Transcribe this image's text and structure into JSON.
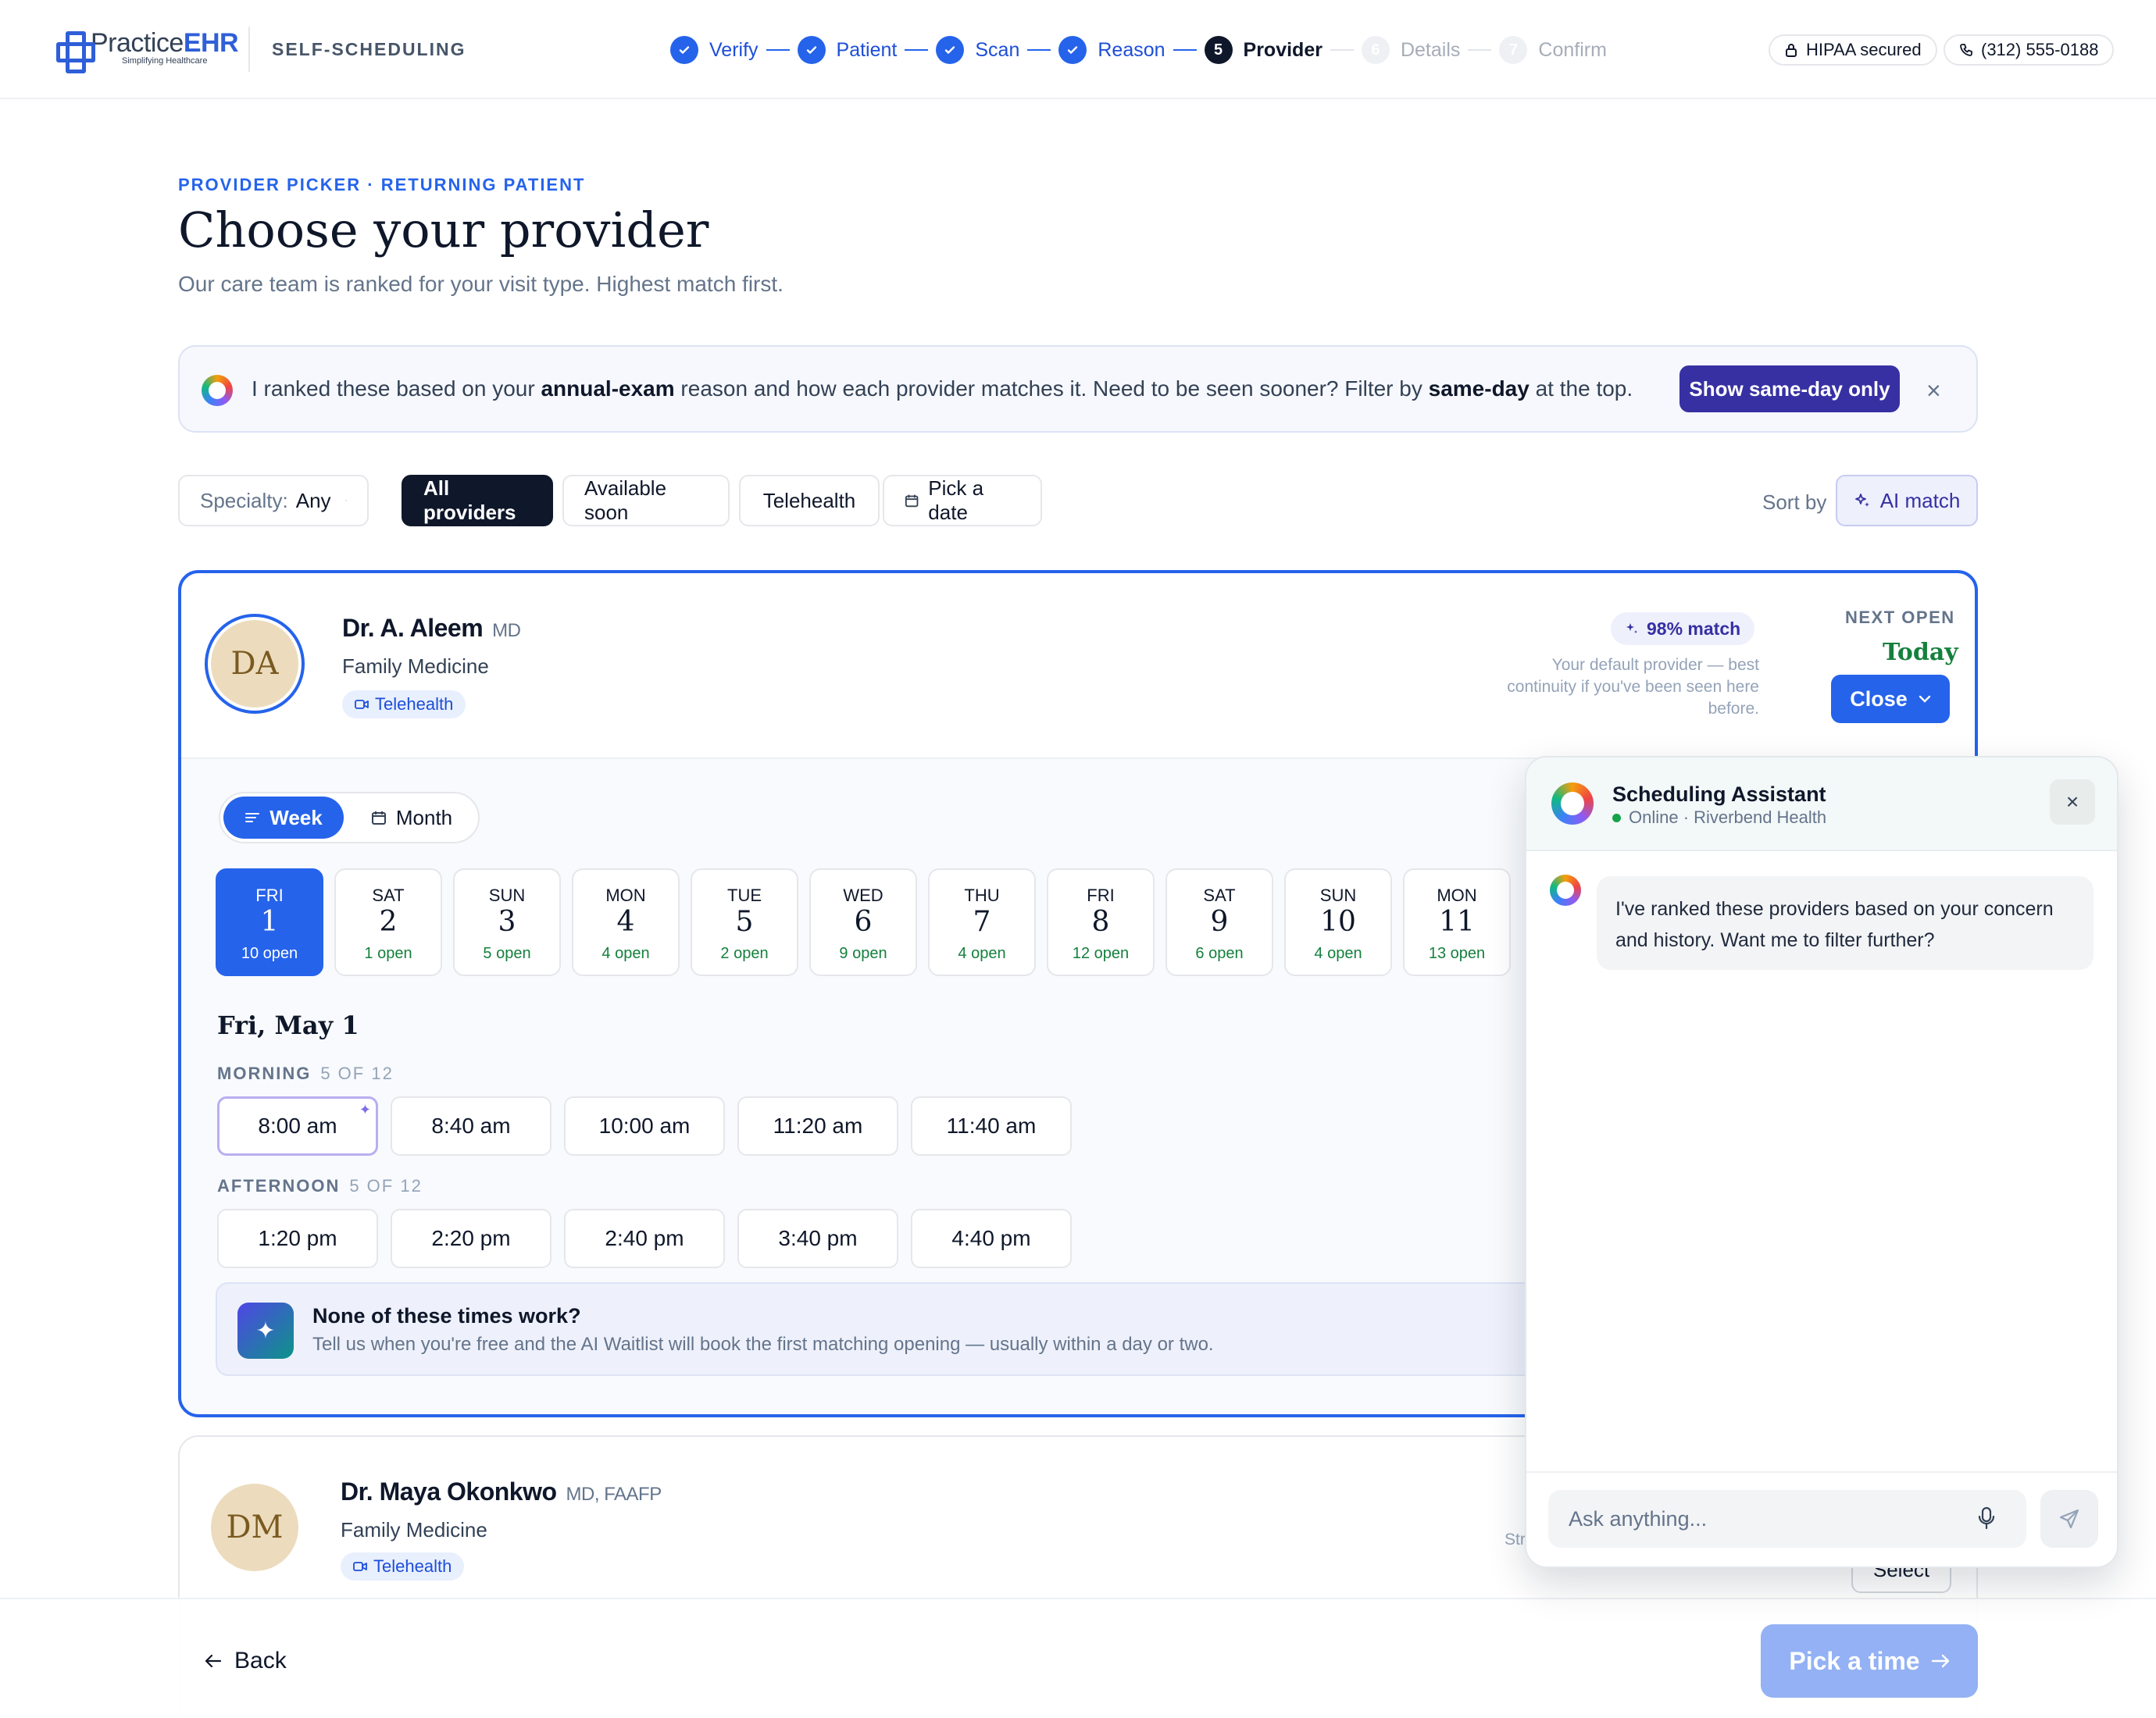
{
  "header": {
    "logo_practice": "Practice",
    "logo_ehr": "EHR",
    "logo_tagline": "Simplifying Healthcare",
    "section": "SELF-SCHEDULING",
    "steps": [
      {
        "label": "Verify",
        "state": "done"
      },
      {
        "label": "Patient",
        "state": "done"
      },
      {
        "label": "Scan",
        "state": "done"
      },
      {
        "label": "Reason",
        "state": "done"
      },
      {
        "label": "Provider",
        "number": "5",
        "state": "current"
      },
      {
        "label": "Details",
        "number": "6",
        "state": "todo"
      },
      {
        "label": "Confirm",
        "number": "7",
        "state": "todo"
      }
    ],
    "hipaa": "HIPAA secured",
    "phone": "(312) 555-0188"
  },
  "page": {
    "eyebrow": "PROVIDER PICKER · RETURNING PATIENT",
    "title": "Choose your provider",
    "subtitle": "Our care team is ranked for your visit type. Highest match first."
  },
  "banner": {
    "text_1": "I ranked these based on your ",
    "bold_1": "annual-exam",
    "text_2": " reason and how each provider matches it. Need to be seen sooner? Filter by ",
    "bold_2": "same-day",
    "text_3": " at the top.",
    "button": "Show same-day only",
    "close": "×"
  },
  "filters": {
    "specialty_label": "Specialty:",
    "specialty_value": "Any",
    "chips": [
      "All providers",
      "Available soon",
      "Telehealth",
      "Pick a date"
    ],
    "sort_label": "Sort by",
    "sort_value": "AI match"
  },
  "provider1": {
    "initials": "DA",
    "name": "Dr. A. Aleem",
    "credentials": "MD",
    "specialty": "Family Medicine",
    "tag": "Telehealth",
    "match": "98% match",
    "note": "Your default provider — best continuity if you've been seen here before.",
    "next_open_label": "NEXT OPEN",
    "next_open_value": "Today",
    "button": "Close",
    "view_week": "Week",
    "view_month": "Month",
    "days": [
      {
        "dow": "FRI",
        "num": "1",
        "open": "10 open",
        "selected": true
      },
      {
        "dow": "SAT",
        "num": "2",
        "open": "1 open"
      },
      {
        "dow": "SUN",
        "num": "3",
        "open": "5 open"
      },
      {
        "dow": "MON",
        "num": "4",
        "open": "4 open"
      },
      {
        "dow": "TUE",
        "num": "5",
        "open": "2 open"
      },
      {
        "dow": "WED",
        "num": "6",
        "open": "9 open"
      },
      {
        "dow": "THU",
        "num": "7",
        "open": "4 open"
      },
      {
        "dow": "FRI",
        "num": "8",
        "open": "12 open"
      },
      {
        "dow": "SAT",
        "num": "9",
        "open": "6 open"
      },
      {
        "dow": "SUN",
        "num": "10",
        "open": "4 open"
      },
      {
        "dow": "MON",
        "num": "11",
        "open": "13 open"
      }
    ],
    "date_heading": "Fri, May 1",
    "morning_label": "MORNING",
    "morning_count": "5 OF 12",
    "morning_slots": [
      "8:00 am",
      "8:40 am",
      "10:00 am",
      "11:20 am",
      "11:40 am"
    ],
    "afternoon_label": "AFTERNOON",
    "afternoon_count": "5 OF 12",
    "afternoon_slots": [
      "1:20 pm",
      "2:20 pm",
      "2:40 pm",
      "3:40 pm",
      "4:40 pm"
    ],
    "waitlist_title": "None of these times work?",
    "waitlist_sub": "Tell us when you're free and the AI Waitlist will book the first matching opening — usually within a day or two."
  },
  "provider2": {
    "initials": "DM",
    "name": "Dr. Maya Okonkwo",
    "credentials": "MD, FAAFP",
    "specialty": "Family Medicine",
    "tag": "Telehealth",
    "note_fragment": "Str",
    "button": "Select"
  },
  "footer": {
    "back": "Back",
    "next": "Pick a time"
  },
  "chat": {
    "title": "Scheduling Assistant",
    "status": "Online · Riverbend Health",
    "close": "×",
    "message": "I've ranked these providers based on your concern and history. Want me to filter further?",
    "placeholder": "Ask anything..."
  },
  "colors": {
    "primary": "#2563eb",
    "ai_accent": "#3730a3",
    "open_green": "#15803d",
    "dark": "#0f172a"
  }
}
